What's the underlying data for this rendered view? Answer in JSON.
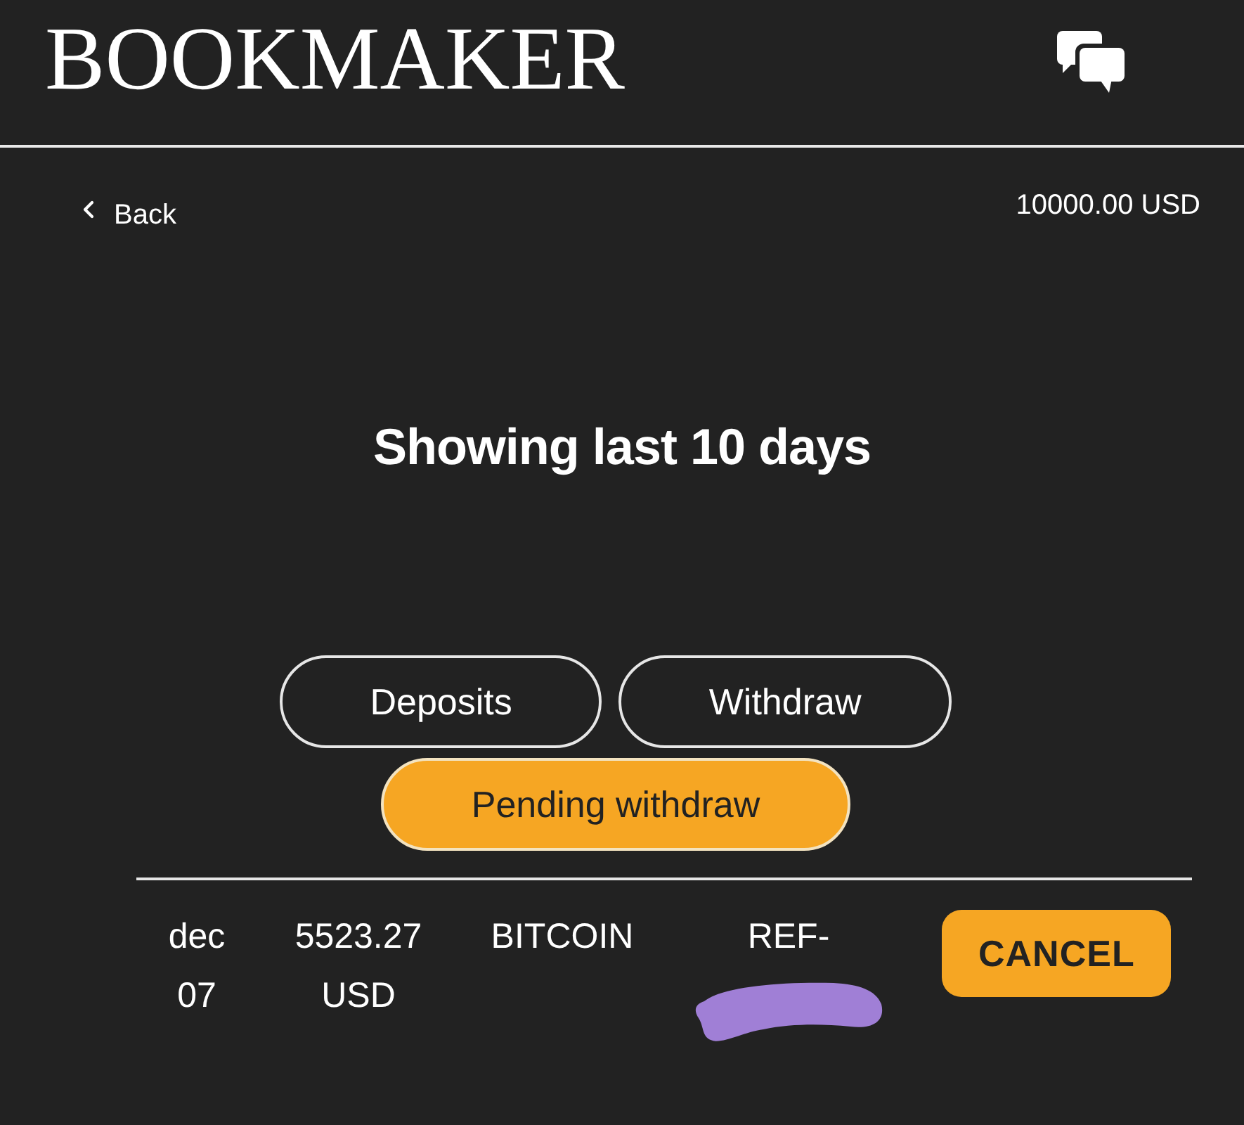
{
  "header": {
    "logo": "BOOKMAKER"
  },
  "nav": {
    "back": "Back",
    "balance": "10000.00 USD"
  },
  "title": "Showing last 10 days",
  "tabs": [
    {
      "label": "Deposits",
      "selected": false
    },
    {
      "label": "Withdraw",
      "selected": false
    },
    {
      "label": "Pending withdraw",
      "selected": true
    }
  ],
  "transactions": [
    {
      "date": "dec 07",
      "amount": "5523.27 USD",
      "method": "BITCOIN",
      "reference": "REF-",
      "action": "CANCEL"
    }
  ]
}
